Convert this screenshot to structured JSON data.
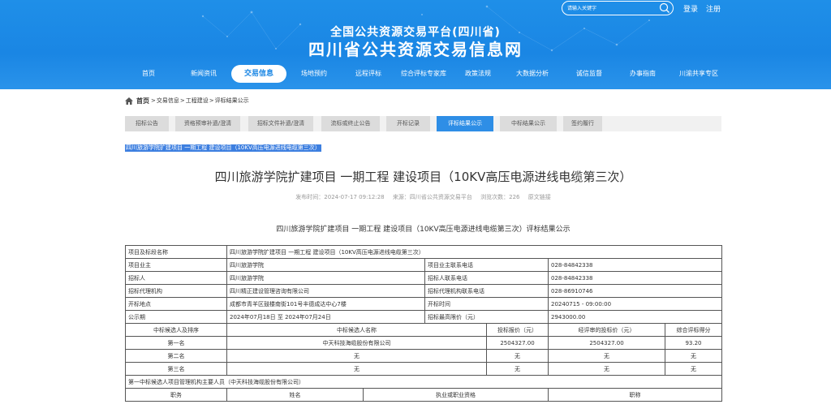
{
  "header": {
    "subtitle": "全国公共资源交易平台(四川省)",
    "title": "四川省公共资源交易信息网",
    "search_placeholder": "请输入关键字",
    "login": "登录",
    "register": "注册"
  },
  "nav": [
    {
      "label": "首页"
    },
    {
      "label": "新闻资讯"
    },
    {
      "label": "交易信息"
    },
    {
      "label": "场地预约"
    },
    {
      "label": "远程评标"
    },
    {
      "label": "综合评标专家库"
    },
    {
      "label": "政策法规"
    },
    {
      "label": "大数据分析"
    },
    {
      "label": "诚信监督"
    },
    {
      "label": "办事指南"
    },
    {
      "label": "川渝共享专区"
    }
  ],
  "breadcrumb": {
    "home": "首页",
    "items": [
      "交易信息",
      "工程建设",
      "评标结果公示"
    ],
    "separator": ">"
  },
  "tabs": [
    {
      "label": "招标公告"
    },
    {
      "label": "资格预审补遗/澄清"
    },
    {
      "label": "招标文件补遗/澄清"
    },
    {
      "label": "流标或终止公告"
    },
    {
      "label": "开标记录"
    },
    {
      "label": "评标结果公示"
    },
    {
      "label": "中标结果公示"
    },
    {
      "label": "签约履行"
    }
  ],
  "selected_title": "四川旅游学院扩建项目 一期工程 建设项目（10KV高压电源进线电缆第三次）",
  "article": {
    "title": "四川旅游学院扩建项目 一期工程 建设项目（10KV高压电源进线电缆第三次）",
    "publish_time": "发布时间：2024-07-17 09:12:28",
    "source": "来源：四川省公共资源交易平台",
    "views": "浏览次数：226",
    "origin_link": "原文链接",
    "subtitle": "四川旅游学院扩建项目 一期工程 建设项目（10KV高压电源进线电缆第三次）评标结果公示"
  },
  "table": {
    "project_label": "项目及标段名称",
    "project_value": "四川旅游学院扩建项目 一期工程 建设项目（10KV高压电源进线电缆第三次）",
    "rows": [
      {
        "l1": "项目业主",
        "v1": "四川旅游学院",
        "l2": "项目业主联系电话",
        "v2": "028-84842338"
      },
      {
        "l1": "招标人",
        "v1": "四川旅游学院",
        "l2": "招标人联系电话",
        "v2": "028-84842338"
      },
      {
        "l1": "招标代理机构",
        "v1": "四川精正建设管理咨询有限公司",
        "l2": "招标代理机构联系电话",
        "v2": "028-86910746"
      },
      {
        "l1": "开标地点",
        "v1": "成都市青羊区鼓楼南街101号丰德成达中心7楼",
        "l2": "开标时间",
        "v2": "20240715 - 09:00:00"
      },
      {
        "l1": "公示期",
        "v1": "2024年07月18日 至 2024年07月24日",
        "l2": "招标最高限价（元）",
        "v2": "2943000.00"
      }
    ],
    "candidate_headers": [
      "中标候选人及排序",
      "中标候选人名称",
      "投标报价（元）",
      "经评审的投标价（元）",
      "综合评标得分"
    ],
    "candidates": [
      {
        "rank": "第一名",
        "name": "中天科技海缆股份有限公司",
        "bid": "2504327.00",
        "reviewed": "2504327.00",
        "score": "93.20"
      },
      {
        "rank": "第二名",
        "name": "无",
        "bid": "无",
        "reviewed": "无",
        "score": "无"
      },
      {
        "rank": "第三名",
        "name": "无",
        "bid": "无",
        "reviewed": "无",
        "score": "无"
      }
    ],
    "manager_label": "第一中标候选人项目管理机构主要人员（中天科技海缆股份有限公司）",
    "staff_headers": [
      "职务",
      "姓名",
      "执业或职业资格",
      "职称"
    ]
  }
}
